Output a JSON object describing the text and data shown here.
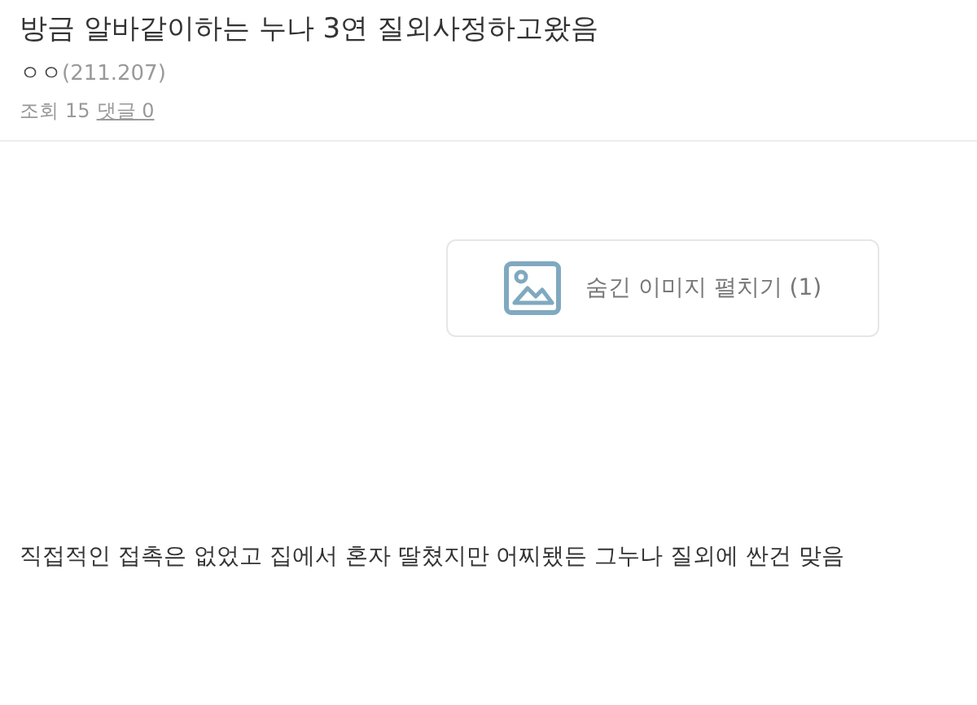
{
  "post": {
    "title": "방금 알바같이하는 누나 3연 질외사정하고왔음",
    "author": "ㅇㅇ",
    "ip": "(211.207)",
    "views_label": "조회",
    "views": "15",
    "comments_link": "댓글 0"
  },
  "hidden_image_button": {
    "label": "숨긴 이미지 펼치기 (1)"
  },
  "body": "직접적인 접촉은 없었고 집에서 혼자 딸쳤지만 어찌됐든 그누나 질외에 싼건 맞음"
}
